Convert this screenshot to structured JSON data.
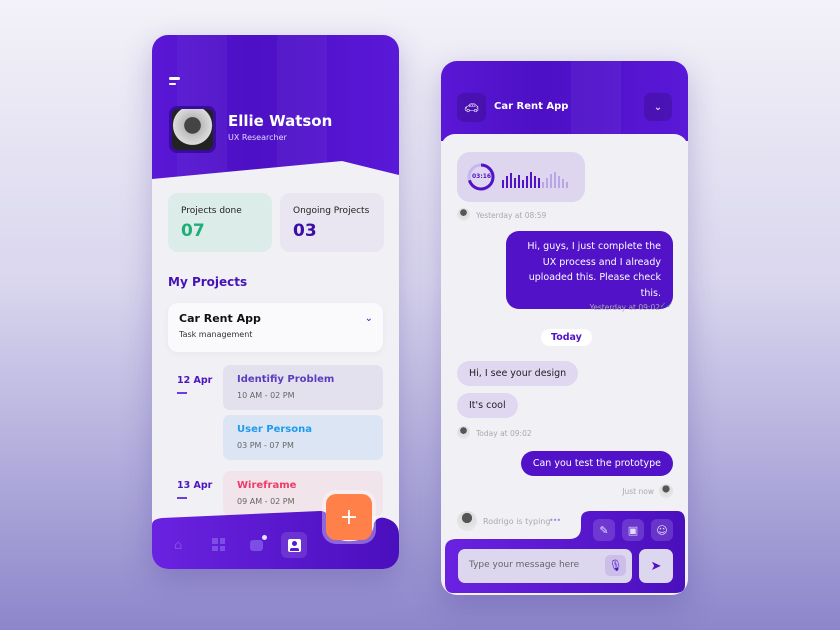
{
  "profile": {
    "name": "Ellie Watson",
    "role": "UX Researcher"
  },
  "stats": [
    {
      "label": "Projects done",
      "value": "07",
      "color": "#1fae7a"
    },
    {
      "label": "Ongoing Projects",
      "value": "03",
      "color": "#3c0ea8"
    }
  ],
  "projects": {
    "heading": "My Projects",
    "selected": {
      "title": "Car Rent App",
      "subtitle": "Task management"
    }
  },
  "schedule": [
    {
      "date": "12 Apr",
      "tasks": [
        {
          "name": "Identifiy Problem",
          "time": "10 AM - 02 PM",
          "color": "#5a3cc0"
        },
        {
          "name": "User Persona",
          "time": "03 PM - 07 PM",
          "color": "#1e9bf0"
        }
      ]
    },
    {
      "date": "13 Apr",
      "tasks": [
        {
          "name": "Wireframe",
          "time": "09 AM - 02 PM",
          "color": "#f03a6a"
        }
      ]
    }
  ],
  "fab": "+",
  "nav": [
    "home-icon",
    "dashboard-icon",
    "chat-icon",
    "profile-icon"
  ],
  "chat": {
    "title": "Car Rent App",
    "voice": {
      "duration": "03:16",
      "progress": 0.7
    },
    "messages": [
      {
        "from": "them",
        "type": "voice",
        "meta": "Yesterday at 08:59"
      },
      {
        "from": "me",
        "text": "Hi, guys, I just complete the UX process and I already uploaded this. Please check this.",
        "meta": "Yesterday at 09:02"
      },
      {
        "divider": "Today"
      },
      {
        "from": "them",
        "text": "Hi, I see your design"
      },
      {
        "from": "them",
        "text": "It's cool",
        "meta": "Today at 09:02"
      },
      {
        "from": "me",
        "text": "Can you test the prototype",
        "meta": "Just now"
      }
    ],
    "typing": "Rodrigo is typing",
    "input_placeholder": "Type your message here"
  },
  "colors": {
    "primary": "#5212c8",
    "accent": "#ff8048"
  }
}
